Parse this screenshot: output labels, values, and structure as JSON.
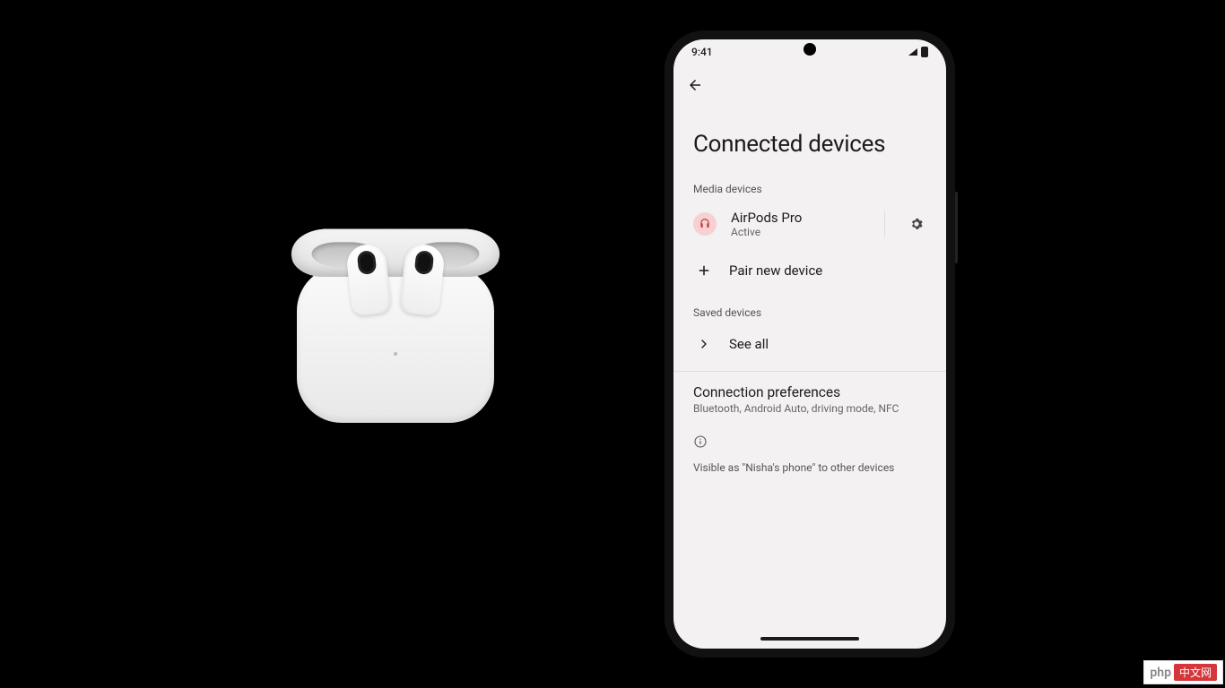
{
  "status": {
    "time": "9:41"
  },
  "page": {
    "title": "Connected devices"
  },
  "sections": {
    "media_label": "Media devices",
    "saved_label": "Saved devices"
  },
  "device": {
    "name": "AirPods Pro",
    "status": "Active"
  },
  "actions": {
    "pair_label": "Pair new device",
    "see_all_label": "See all"
  },
  "prefs": {
    "title": "Connection preferences",
    "subtitle": "Bluetooth, Android Auto, driving mode, NFC"
  },
  "visibility": {
    "text": "Visible as \"Nisha's phone\" to other devices"
  },
  "watermark": {
    "left": "php",
    "right": "中文网"
  }
}
